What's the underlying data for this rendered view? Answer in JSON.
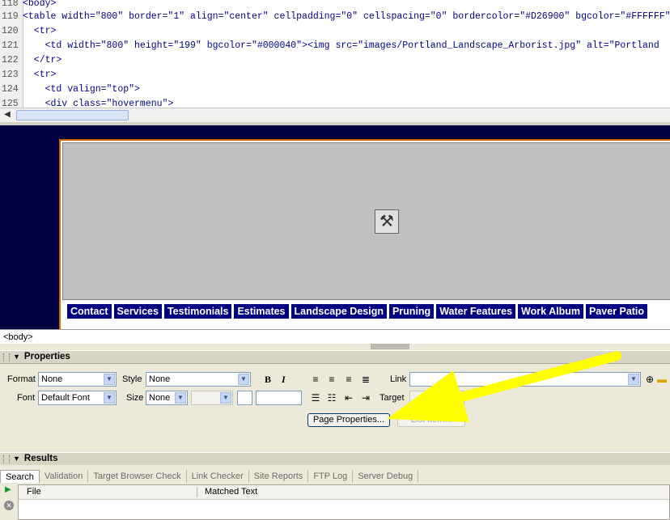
{
  "code": {
    "lines": [
      {
        "n": "118",
        "text": "<body>"
      },
      {
        "n": "119",
        "text": "<table width=\"800\" border=\"1\" align=\"center\" cellpadding=\"0\" cellspacing=\"0\" bordercolor=\"#D26900\" bgcolor=\"#FFFFFF\""
      },
      {
        "n": "120",
        "text": "  <tr>"
      },
      {
        "n": "121",
        "text": "    <td width=\"800\" height=\"199\" bgcolor=\"#000040\"><img src=\"images/Portland_Landscape_Arborist.jpg\" alt=\"Portland"
      },
      {
        "n": "122",
        "text": "  </tr>"
      },
      {
        "n": "123",
        "text": "  <tr>"
      },
      {
        "n": "124",
        "text": "    <td valign=\"top\">"
      },
      {
        "n": "125",
        "text": "    <div class=\"hovermenu\">"
      }
    ]
  },
  "design": {
    "menu": [
      "Contact",
      "Services",
      "Testimonials",
      "Estimates",
      "Landscape Design",
      "Pruning",
      "Water Features",
      "Work Album",
      "Paver Patio"
    ],
    "border_color": "#D26900",
    "bg_color": "#000040"
  },
  "tagbar": {
    "tag": "<body>"
  },
  "properties": {
    "title": "Properties",
    "format_label": "Format",
    "format_value": "None",
    "style_label": "Style",
    "style_value": "None",
    "font_label": "Font",
    "font_value": "Default Font",
    "size_label": "Size",
    "size_value": "None",
    "bold": "B",
    "italic": "I",
    "link_label": "Link",
    "target_label": "Target",
    "page_properties_btn": "Page Properties...",
    "list_item_btn": "List Item..."
  },
  "results": {
    "title": "Results",
    "tabs": [
      "Search",
      "Validation",
      "Target Browser Check",
      "Link Checker",
      "Site Reports",
      "FTP Log",
      "Server Debug"
    ],
    "active_tab": "Search",
    "columns": [
      "File",
      "Matched Text"
    ]
  },
  "annotation": {
    "arrow_color": "#FFFF00"
  }
}
